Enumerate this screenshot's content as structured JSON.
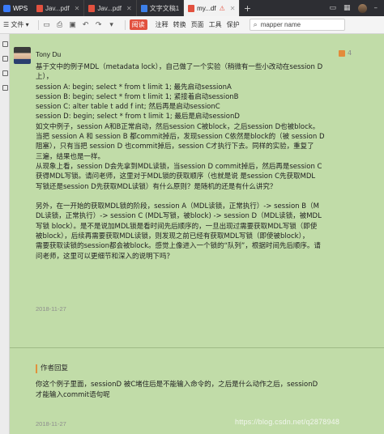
{
  "tabbar": {
    "app": "WPS",
    "tabs": [
      {
        "label": "Jav...pdf",
        "type": "pdf"
      },
      {
        "label": "Jav...pdf",
        "type": "pdf"
      },
      {
        "label": "文字文稿1",
        "type": "doc"
      },
      {
        "label": "my...df",
        "type": "pdf"
      }
    ],
    "add_label": "+"
  },
  "toolbar": {
    "file_label": "文件",
    "read_label": "阅读",
    "annotate_label": "注释",
    "convert_label": "转换",
    "page_label": "页面",
    "tools_label": "工具",
    "protect_label": "保护",
    "search_value": "mapper name"
  },
  "post": {
    "author": "Tony Du",
    "likes": "4",
    "lines": [
      "基于文中的例子MDL（metadata lock），自己做了一个实验（稍微有一些小改动在session D",
      "上），",
      "session A: begin; select * from t limit 1; 最先启动sessionA",
      "session B: begin; select * from t limit 1; 紧接着启动sessionB",
      "session C: alter table t add f int; 然后再是启动sessionC",
      "session D: begin; select * from t limit 1; 最后是启动sessionD",
      "如文中例子，session A和B正常启动，然后session C被block，之后session D也被block。",
      "当把 session A 和 session B 都commit掉后，发现session C依然是block的（被 session D",
      "阻塞），只有当把 session D 也commit掉后，session C才执行下去。同样的实验，重复了",
      "三遍，结果也是一样。",
      "从现象上看，session D会先拿到MDL读锁，当session D commit掉后，然后再是session C",
      "获得MDL写锁。请问老师，这里对于MDL锁的获取顺序（也就是说 是session C先获取MDL",
      "写锁还是session D先获取MDL读锁）有什么原则？是随机的还是有什么讲究？"
    ],
    "lines2": [
      "另外，在一开始的获取MDL锁的阶段，session A（MDL读锁，正常执行）-> session B（M",
      "DL读锁，正常执行）-> session C (MDL写锁，被block) -> session D（MDL读锁，被MDL",
      "写锁 block）。是不是说加MDL锁是看时间先后顺序的，一旦出现过需要获取MDL写锁（即使",
      "被block），后续再需要获取MDL读锁，则发现之前已经有获取MDL写锁（即使被block），",
      "需要获取读锁的session都会被block。感觉上像进入一个锁的“队列”，根据时间先后顺序。请",
      "问老师，这里可以更细节和深入的说明下吗？"
    ],
    "date": "2018-11-27"
  },
  "reply": {
    "header": "作者回复",
    "lines": [
      "你这个例子里面，sessionD 被C堵住后是不能输入命令的，之后是什么动作之后，sessionD",
      "才能输入commit语句呢"
    ],
    "date": "2018-11-27"
  },
  "watermark": "https://blog.csdn.net/q2878948"
}
